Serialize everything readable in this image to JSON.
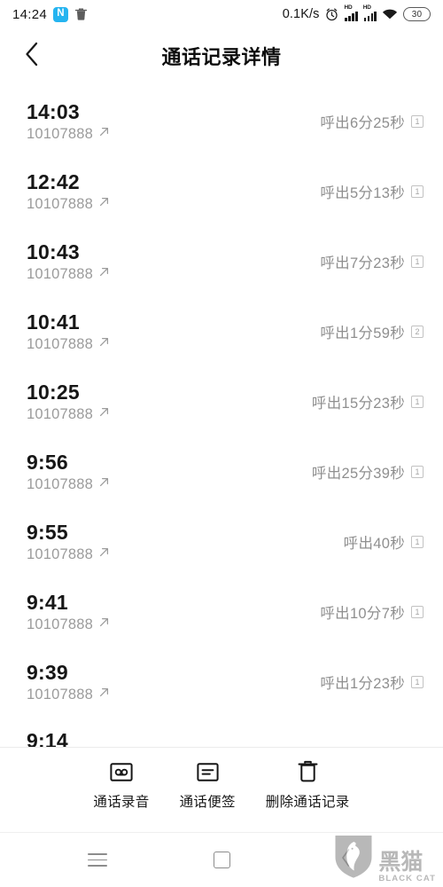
{
  "status_bar": {
    "time": "14:24",
    "nfc_label": "N",
    "trash_icon": "trash-icon",
    "network_speed": "0.1K/s",
    "alarm_icon": "alarm-clock-icon",
    "sim1_tag": "HD",
    "sim2_tag": "HD",
    "wifi_icon": "wifi-icon",
    "battery_level": "30"
  },
  "app_bar": {
    "back_icon": "chevron-left-icon",
    "title": "通话记录详情"
  },
  "call_list": {
    "rows": [
      {
        "time": "14:03",
        "number": "10107888",
        "direction_icon": "outgoing-call-arrow",
        "duration": "呼出6分25秒",
        "sim": "1"
      },
      {
        "time": "12:42",
        "number": "10107888",
        "direction_icon": "outgoing-call-arrow",
        "duration": "呼出5分13秒",
        "sim": "1"
      },
      {
        "time": "10:43",
        "number": "10107888",
        "direction_icon": "outgoing-call-arrow",
        "duration": "呼出7分23秒",
        "sim": "1"
      },
      {
        "time": "10:41",
        "number": "10107888",
        "direction_icon": "outgoing-call-arrow",
        "duration": "呼出1分59秒",
        "sim": "2"
      },
      {
        "time": "10:25",
        "number": "10107888",
        "direction_icon": "outgoing-call-arrow",
        "duration": "呼出15分23秒",
        "sim": "1"
      },
      {
        "time": "9:56",
        "number": "10107888",
        "direction_icon": "outgoing-call-arrow",
        "duration": "呼出25分39秒",
        "sim": "1"
      },
      {
        "time": "9:55",
        "number": "10107888",
        "direction_icon": "outgoing-call-arrow",
        "duration": "呼出40秒",
        "sim": "1"
      },
      {
        "time": "9:41",
        "number": "10107888",
        "direction_icon": "outgoing-call-arrow",
        "duration": "呼出10分7秒",
        "sim": "1"
      },
      {
        "time": "9:39",
        "number": "10107888",
        "direction_icon": "outgoing-call-arrow",
        "duration": "呼出1分23秒",
        "sim": "1"
      }
    ],
    "partial_row": {
      "time": "9:14"
    }
  },
  "action_bar": {
    "items": [
      {
        "label": "通话录音",
        "icon": "call-recording-icon"
      },
      {
        "label": "通话便签",
        "icon": "call-note-icon"
      },
      {
        "label": "删除通话记录",
        "icon": "delete-trash-icon"
      }
    ]
  },
  "nav_bar": {
    "recents_icon": "menu-recents-icon",
    "home_icon": "home-square-icon",
    "back_icon": "nav-back-chevron-icon"
  },
  "watermark": {
    "cn": "黑猫",
    "en": "BLACK CAT",
    "shield_icon": "black-cat-shield-logo"
  },
  "colors": {
    "background": "#ffffff",
    "primary_text": "#161616",
    "secondary_text": "#9b9b9b",
    "nfc_blue": "#25b4f0",
    "divider": "#ececec"
  }
}
